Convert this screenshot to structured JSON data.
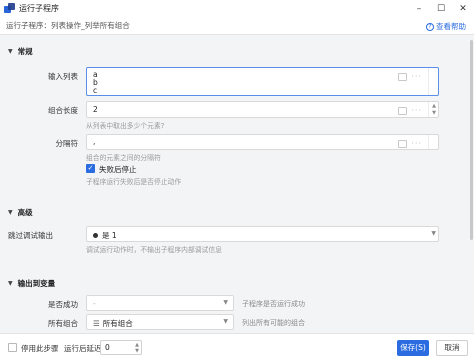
{
  "window": {
    "title": "运行子程序",
    "controls": [
      "–",
      "☐",
      "✕"
    ]
  },
  "header": {
    "breadcrumb": "运行子程序：列表操作_列举所有组合",
    "help_link": "查看帮助"
  },
  "sections": {
    "general": "常规",
    "advanced": "高级",
    "output": "输出到变量"
  },
  "fields": {
    "input_list": {
      "label": "输入列表",
      "lines": [
        "a",
        "b",
        "c"
      ]
    },
    "combo_length": {
      "label": "组合长度",
      "value": "2",
      "hint": "从列表中取出多少个元素?"
    },
    "separator": {
      "label": "分隔符",
      "value": ",",
      "hint": "组合的元素之间的分隔符"
    },
    "stop_on_fail": {
      "label": "失败后停止",
      "checked": true,
      "hint": "子程序运行失败后是否停止动作"
    },
    "debug_output": {
      "label": "跳过调试输出",
      "value": "是 1",
      "hint": "调试运行动作时，不输出子程序内部调试信息"
    }
  },
  "outputs": [
    {
      "label": "是否成功",
      "value": "-",
      "muted": true,
      "desc": "子程序是否运行成功"
    },
    {
      "label": "所有组合",
      "value": "所有组合",
      "muted": false,
      "desc": "列出所有可能的组合"
    }
  ],
  "footer": {
    "disable_step": "停用此步骤",
    "delay_label": "运行后延迟:",
    "delay_value": "0",
    "save": "保存(S)",
    "cancel": "取消"
  },
  "colors": {
    "accent": "#2b6de0"
  }
}
